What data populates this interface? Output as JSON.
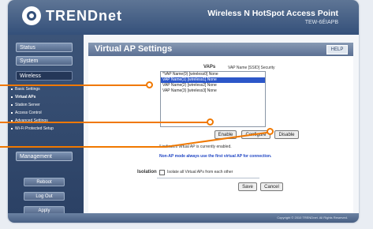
{
  "header": {
    "logo": "TRENDnet",
    "product_name": "Wireless N HotSpot Access Point",
    "model": "TEW-6ÉIAPB"
  },
  "sidebar": {
    "status": "Status",
    "system": "System",
    "wireless": "Wireless",
    "sub_items": [
      "Basic Settings",
      "Virtual APs",
      "Station Server",
      "Access Control",
      "Advanced Settings",
      "Wi-Fi Protected Setup"
    ],
    "management": "Management",
    "reboot": "Reboot",
    "logout": "Log Out",
    "apply": "Apply"
  },
  "page": {
    "title": "Virtual AP Settings",
    "help": "HELP",
    "vaps_label": "VAPs",
    "list_header": "VAP Name [SSID] Security",
    "vaps": [
      "*VAP Name(0) [wireless0] None",
      "VAP Name(1) [wireless1] None",
      "VAP Name(2) [wireless2] None",
      "VAP Name(3) [wireless3] None"
    ],
    "enable": "Enable",
    "configure": "Configure",
    "disable": "Disable",
    "note_asterisk": "* indicates virtual AP is currently enabled.",
    "note_wds": "Non-AP mode always use the first virtual AP for connection.",
    "isolation_label": "Isolation",
    "isolation_text": "Isolate all Virtual APs from each other",
    "save": "Save",
    "cancel": "Cancel"
  },
  "footer": {
    "copyright": "Copyright © 2010 TRENDnet. All Rights Reserved."
  },
  "colors": {
    "callout": "#f07800"
  }
}
